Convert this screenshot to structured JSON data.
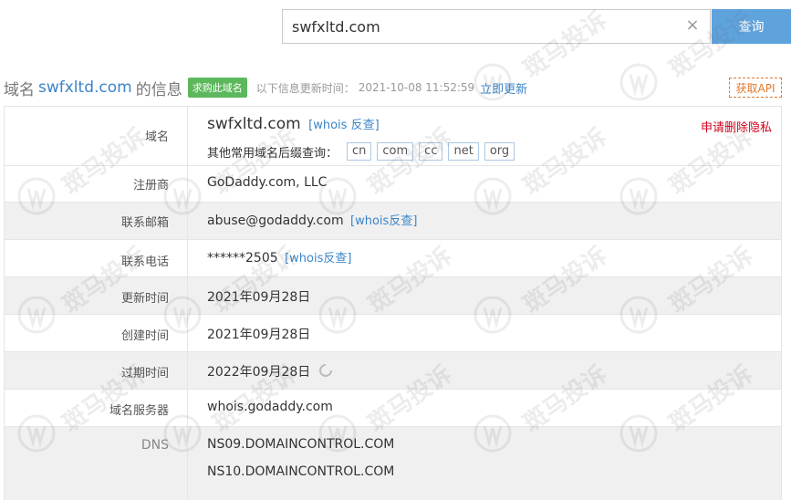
{
  "search": {
    "value": "swfxltd.com",
    "clear_glyph": "×",
    "button_label": "查询"
  },
  "header": {
    "prefix": "域名",
    "domain": "swfxltd.com",
    "suffix": "的信息",
    "buy_badge": "求购此域名",
    "update_label": "以下信息更新时间：",
    "update_time": "2021-10-08 11:52:59",
    "update_link": "立即更新",
    "api_button": "获取API"
  },
  "whois": {
    "domain_label": "域名",
    "domain_value": "swfxltd.com",
    "whois_reverse_link": "[whois 反查]",
    "privacy_link": "申请删除隐私",
    "suffix_label": "其他常用域名后缀查询：",
    "tlds": [
      "cn",
      "com",
      "cc",
      "net",
      "org"
    ],
    "registrar_label": "注册商",
    "registrar_value": "GoDaddy.com, LLC",
    "email_label": "联系邮箱",
    "email_value": "abuse@godaddy.com",
    "email_reverse_link": "[whois反查]",
    "phone_label": "联系电话",
    "phone_value": "******2505",
    "phone_reverse_link": "[whois反查]",
    "updated_label": "更新时间",
    "updated_value": "2021年09月28日",
    "created_label": "创建时间",
    "created_value": "2021年09月28日",
    "expires_label": "过期时间",
    "expires_value": "2022年09月28日",
    "server_label": "域名服务器",
    "server_value": "whois.godaddy.com",
    "dns_label": "DNS",
    "dns_values": [
      "NS09.DOMAINCONTROL.COM",
      "NS10.DOMAINCONTROL.COM"
    ]
  },
  "watermark": {
    "text": "斑马投诉"
  },
  "colors": {
    "accent": "#3a84c8",
    "search_button": "#5fa3dd",
    "badge_green": "#5cb85c",
    "privacy_red": "#d0021b",
    "api_orange": "#e07a2e",
    "row_alt": "#f0f0f0"
  }
}
